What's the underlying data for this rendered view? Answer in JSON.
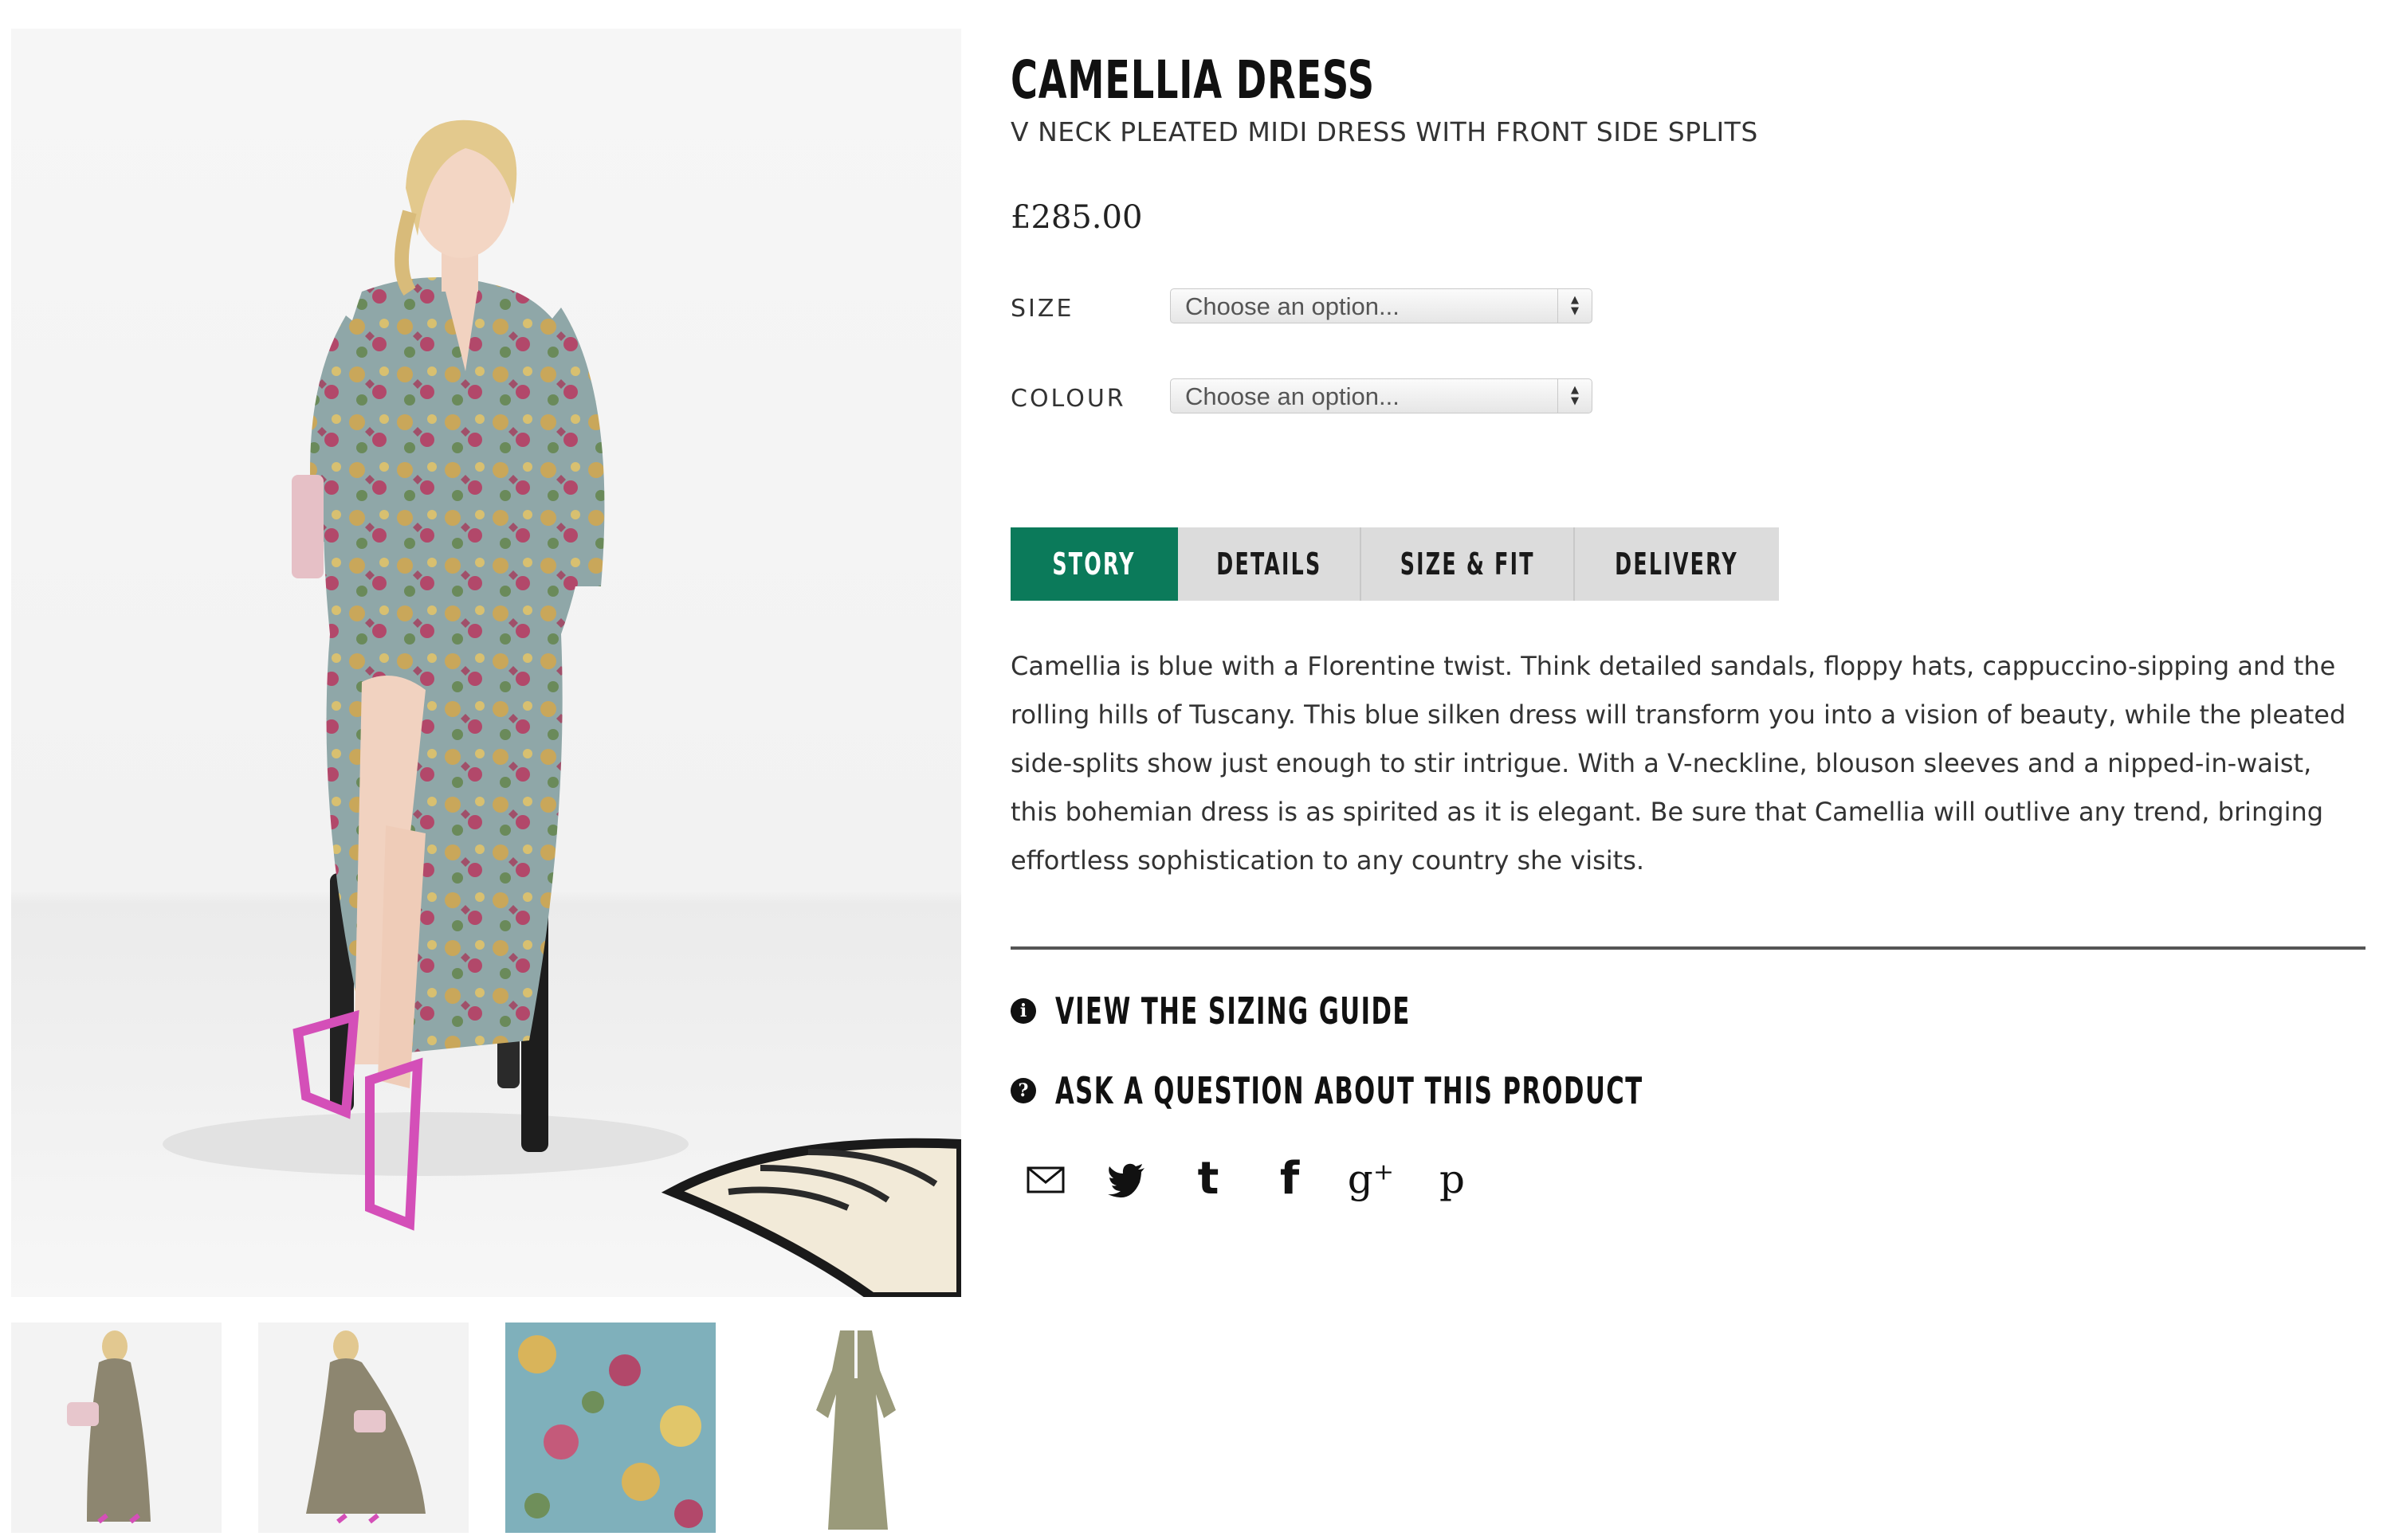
{
  "product": {
    "title": "CAMELLIA DRESS",
    "subtitle": "V NECK PLEATED MIDI DRESS WITH FRONT SIDE SPLITS",
    "price": "£285.00"
  },
  "options": {
    "size": {
      "label": "SIZE",
      "selected": "Choose an option..."
    },
    "colour": {
      "label": "COLOUR",
      "selected": "Choose an option..."
    }
  },
  "tabs": [
    {
      "label": "STORY",
      "active": true
    },
    {
      "label": "DETAILS",
      "active": false
    },
    {
      "label": "SIZE & FIT",
      "active": false
    },
    {
      "label": "DELIVERY",
      "active": false
    }
  ],
  "description": "Camellia is blue with a Florentine twist. Think detailed sandals, floppy hats, cappuccino-sipping and the rolling hills of Tuscany. This blue silken dress will transform you into a vision of beauty, while the pleated side-splits show just enough to stir intrigue. With a V-neckline, blouson sleeves and a nipped-in-waist, this bohemian dress is as spirited as it is elegant. Be sure that Camellia will outlive any trend, bringing effortless sophistication to any country she visits.",
  "links": {
    "sizing_guide": {
      "icon": "info-icon",
      "label": "VIEW THE SIZING GUIDE"
    },
    "ask_question": {
      "icon": "question-icon",
      "label": "ASK A QUESTION ABOUT THIS PRODUCT"
    }
  },
  "share": [
    {
      "name": "email",
      "icon": "email-icon"
    },
    {
      "name": "twitter",
      "icon": "twitter-icon"
    },
    {
      "name": "tumblr",
      "icon": "tumblr-icon"
    },
    {
      "name": "facebook",
      "icon": "facebook-icon"
    },
    {
      "name": "google-plus",
      "icon": "google-plus-icon"
    },
    {
      "name": "pinterest",
      "icon": "pinterest-icon"
    }
  ],
  "gallery": {
    "main_image": "model-seated-in-floral-dress",
    "thumbnails": [
      "model-front-view",
      "model-back-view",
      "fabric-print-closeup",
      "dress-flat-lay"
    ]
  },
  "colors": {
    "accent": "#0b7a5a",
    "tab_inactive": "#dcdcdc",
    "text_dark": "#111111"
  }
}
